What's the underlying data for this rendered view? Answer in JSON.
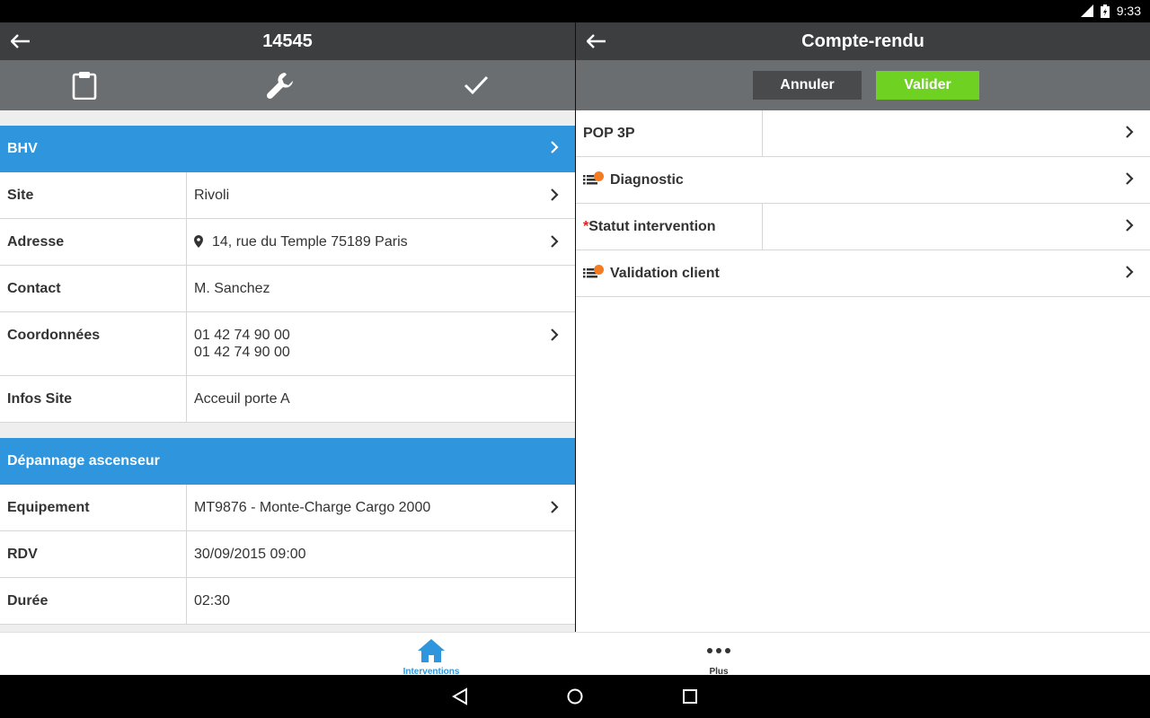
{
  "status_bar": {
    "network": "3G",
    "time": "9:33"
  },
  "left_pane": {
    "title": "14545",
    "sections": [
      {
        "header": "BHV",
        "rows": [
          {
            "label": "Site",
            "value": "Rivoli"
          },
          {
            "label": "Adresse",
            "value": "14, rue du Temple 75189 Paris"
          },
          {
            "label": "Contact",
            "value": "M. Sanchez"
          },
          {
            "label": "Coordonnées",
            "value_lines": [
              "01 42 74 90 00",
              "01 42 74 90 00"
            ]
          },
          {
            "label": "Infos Site",
            "value": "Acceuil porte A"
          }
        ]
      },
      {
        "header": "Dépannage ascenseur",
        "rows": [
          {
            "label": "Equipement",
            "value": "MT9876 - Monte-Charge Cargo 2000"
          },
          {
            "label": "RDV",
            "value": "30/09/2015 09:00"
          },
          {
            "label": "Durée",
            "value": "02:30"
          }
        ]
      }
    ]
  },
  "right_pane": {
    "title": "Compte-rendu",
    "cancel_label": "Annuler",
    "validate_label": "Valider",
    "rows": [
      {
        "label": "POP 3P"
      },
      {
        "label": "Diagnostic"
      },
      {
        "required_mark": "*",
        "label": "Statut intervention"
      },
      {
        "label": "Validation client"
      }
    ]
  },
  "bottom_nav": {
    "items": [
      {
        "label": "Interventions",
        "icon": "home-icon"
      },
      {
        "label": "Plus",
        "icon": "more-icon"
      }
    ]
  },
  "colors": {
    "appbar": "#3c3e40",
    "toolbar": "#6b6e71",
    "section_header": "#2f96dd",
    "validate": "#6fd122",
    "badge": "#f47b20"
  }
}
